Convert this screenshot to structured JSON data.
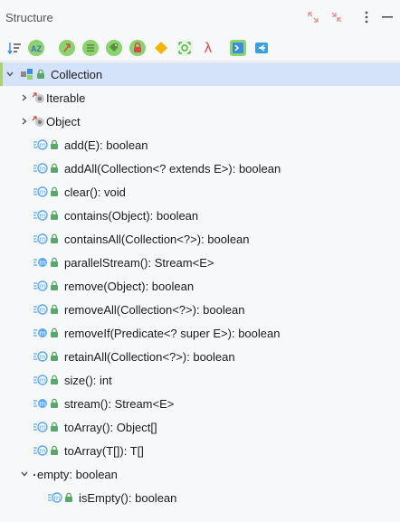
{
  "panel": {
    "title": "Structure"
  },
  "icons": {
    "header": [
      "expand-icon",
      "collapse-icon",
      "more-options-icon",
      "minimize-icon"
    ],
    "toolbar": [
      "sort-by-visibility-icon",
      "sort-alphabetically-icon",
      "show-inherited-icon",
      "show-fields-icon",
      "show-properties-icon",
      "show-non-public-icon",
      "show-toggles-icon",
      "show-anonymous-classes-icon",
      "show-lambdas-icon",
      "navigate-with-single-click-icon",
      "autoscroll-from-source-icon"
    ]
  },
  "colors": {
    "accent": "#3c8dd9",
    "selection": "#d5e3fa",
    "selected_bar": "#a9d36e",
    "lock": "#59a869",
    "method": "#59a8ff"
  },
  "tree": {
    "root": {
      "label": "Collection"
    },
    "supertypes": [
      {
        "label": "Iterable"
      },
      {
        "label": "Object"
      }
    ],
    "methods": [
      {
        "label": "add(E): boolean"
      },
      {
        "label": "addAll(Collection<? extends E>): boolean"
      },
      {
        "label": "clear(): void"
      },
      {
        "label": "contains(Object): boolean"
      },
      {
        "label": "containsAll(Collection<?>): boolean"
      },
      {
        "label": "parallelStream(): Stream<E>"
      },
      {
        "label": "remove(Object): boolean"
      },
      {
        "label": "removeAll(Collection<?>): boolean"
      },
      {
        "label": "removeIf(Predicate<? super E>): boolean"
      },
      {
        "label": "retainAll(Collection<?>): boolean"
      },
      {
        "label": "size(): int"
      },
      {
        "label": "stream(): Stream<E>"
      },
      {
        "label": "toArray(): Object[]"
      },
      {
        "label": "toArray(T[]): T[]"
      }
    ],
    "property": {
      "label": "empty: boolean",
      "children": [
        {
          "label": "isEmpty(): boolean"
        }
      ]
    }
  }
}
